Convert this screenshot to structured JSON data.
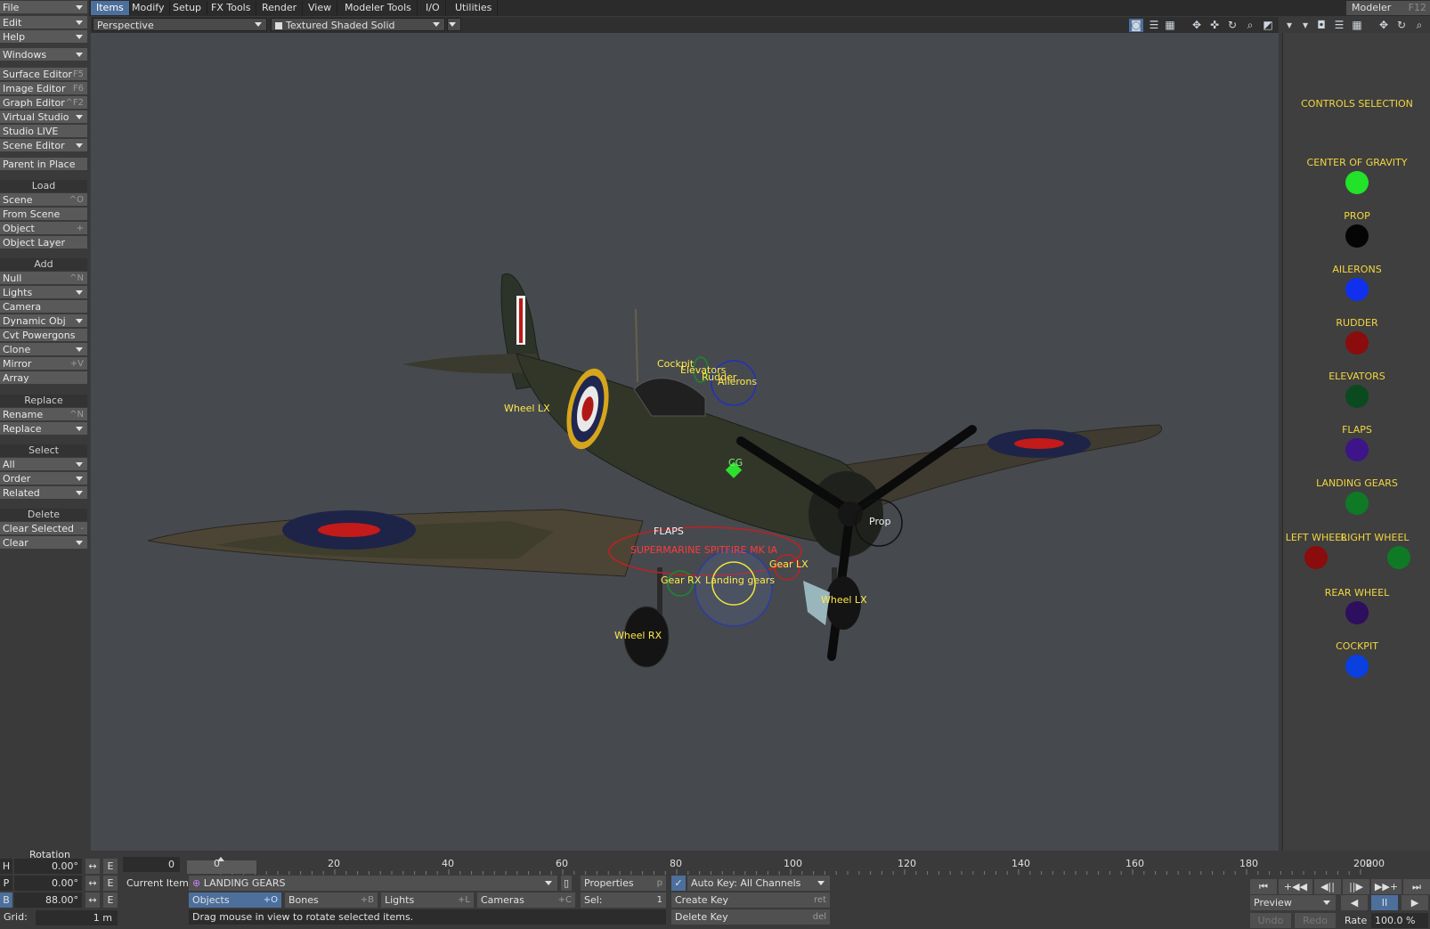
{
  "menu": {
    "file": "File",
    "edit": "Edit",
    "help": "Help",
    "windows": "Windows",
    "tabs": [
      "Items",
      "Modify",
      "Setup",
      "FX Tools",
      "Render",
      "View",
      "Modeler Tools",
      "I/O",
      "Utilities"
    ],
    "modeler": "Modeler",
    "modeler_shortcut": "F12"
  },
  "left": {
    "surface_editor": "Surface Editor",
    "surface_editor_sc": "F5",
    "image_editor": "Image Editor",
    "image_editor_sc": "F6",
    "graph_editor": "Graph Editor",
    "graph_editor_sc": "^F2",
    "virtual_studio": "Virtual Studio",
    "studio_live": "Studio LIVE",
    "scene_editor": "Scene Editor",
    "parent_in_place": "Parent in Place",
    "load_head": "Load",
    "scene": "Scene",
    "scene_sc": "^O",
    "from_scene": "From Scene",
    "object": "Object",
    "object_sc": "+",
    "object_layer": "Object Layer",
    "add_head": "Add",
    "null": "Null",
    "null_sc": "^N",
    "lights": "Lights",
    "camera": "Camera",
    "dynamic_obj": "Dynamic Obj",
    "cvt_powergons": "Cvt Powergons",
    "clone": "Clone",
    "mirror": "Mirror",
    "mirror_sc": "+V",
    "array": "Array",
    "replace_head": "Replace",
    "rename": "Rename",
    "rename_sc": "^N",
    "replace": "Replace",
    "select_head": "Select",
    "all": "All",
    "order": "Order",
    "related": "Related",
    "delete_head": "Delete",
    "clear_selected": "Clear Selected",
    "clear_selected_sc": "-",
    "clear": "Clear"
  },
  "viewport": {
    "view_mode": "Perspective",
    "render_mode": "Textured Shaded Solid",
    "labels": {
      "cockpit": "Cockpit",
      "elevators": "Elevators",
      "rudder": "Rudder",
      "ailerons": "Ailerons",
      "wheel_lx_top": "Wheel LX",
      "cg": "CG",
      "prop": "Prop",
      "flaps": "FLAPS",
      "title": "SUPERMARINE SPITFIRE MK IA",
      "gear_lx": "Gear LX",
      "gear_rx": "Gear RX",
      "landing_gears": "Landing gears",
      "wheel_lx": "Wheel LX",
      "wheel_rx": "Wheel RX"
    }
  },
  "controls": {
    "title": "CONTROLS SELECTION",
    "items": [
      {
        "label": "CENTER OF GRAVITY",
        "color": "#22e22a"
      },
      {
        "label": "PROP",
        "color": "#050505"
      },
      {
        "label": "AILERONS",
        "color": "#1030ee"
      },
      {
        "label": "RUDDER",
        "color": "#8a0c0c"
      },
      {
        "label": "ELEVATORS",
        "color": "#0b4a1e"
      },
      {
        "label": "FLAPS",
        "color": "#3d1588"
      },
      {
        "label": "LANDING GEARS",
        "color": "#0e7a26"
      },
      {
        "label": "LEFT WHEEL",
        "color": "#8a0c0c"
      },
      {
        "label": "RIGHT WHEEL",
        "color": "#0e7a26"
      },
      {
        "label": "REAR WHEEL",
        "color": "#2e0e5e"
      },
      {
        "label": "COCKPIT",
        "color": "#0a3fe0"
      }
    ]
  },
  "timeline": {
    "current_frame": "0",
    "ticks": [
      "0",
      "20",
      "40",
      "60",
      "80",
      "100",
      "120",
      "140",
      "160",
      "180",
      "200"
    ],
    "end_frame": "200"
  },
  "rotation": {
    "title": "Rotation",
    "h_label": "H",
    "h_value": "0.00°",
    "p_label": "P",
    "p_value": "0.00°",
    "b_label": "B",
    "b_value": "88.00°",
    "e": "E",
    "grid_label": "Grid:",
    "grid_value": "1 m"
  },
  "bottom": {
    "frame_field": "0",
    "current_item_label": "Current Item",
    "current_item": "LANDING GEARS",
    "properties": "Properties",
    "properties_sc": "p",
    "auto_key": "Auto Key: All Channels",
    "objects": "Objects",
    "objects_sc": "+O",
    "bones": "Bones",
    "bones_sc": "+B",
    "lights": "Lights",
    "lights_sc": "+L",
    "cameras": "Cameras",
    "cameras_sc": "+C",
    "sel_label": "Sel:",
    "sel_value": "1",
    "create_key": "Create Key",
    "create_key_sc": "ret",
    "delete_key": "Delete Key",
    "delete_key_sc": "del",
    "status": "Drag mouse in view to rotate selected items.",
    "preview": "Preview",
    "undo": "Undo",
    "redo": "Redo",
    "rate_label": "Rate",
    "rate_value": "100.0 %"
  }
}
